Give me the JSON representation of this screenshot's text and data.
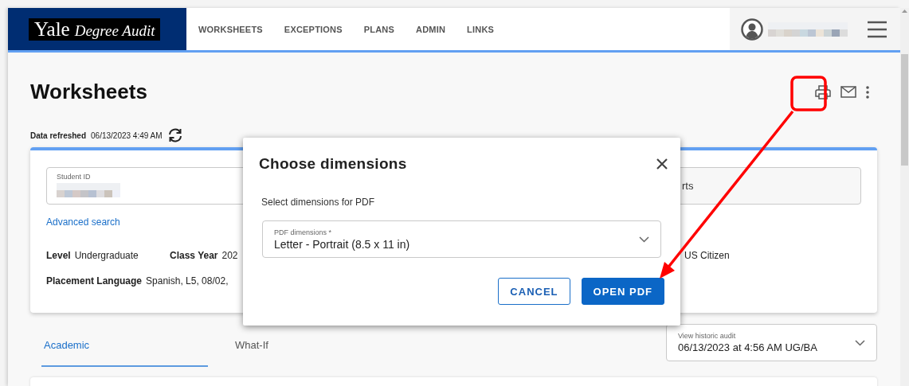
{
  "header": {
    "logo": {
      "brand": "Yale",
      "product": "Degree Audit"
    },
    "nav": [
      {
        "label": "WORKSHEETS"
      },
      {
        "label": "EXCEPTIONS"
      },
      {
        "label": "PLANS"
      },
      {
        "label": "ADMIN"
      },
      {
        "label": "LINKS"
      }
    ]
  },
  "page": {
    "title": "Worksheets",
    "refreshed_label": "Data refreshed",
    "refreshed_value": "06/13/2023 4:49 AM"
  },
  "search_card": {
    "student_id_label": "Student ID",
    "field_2_value": "rts",
    "link": "Advanced search",
    "info": [
      {
        "label": "Level",
        "value": "Undergraduate"
      },
      {
        "label": "Class Year",
        "value": "202"
      }
    ],
    "info_right_value": "US Citizen",
    "info_row2": {
      "label": "Placement Language",
      "value": "Spanish, L5, 08/02,"
    }
  },
  "tabs": [
    {
      "label": "Academic",
      "selected": true
    },
    {
      "label": "What-If",
      "selected": false
    }
  ],
  "history": {
    "label": "View historic audit",
    "value": "06/13/2023 at 4:56 AM UG/BA"
  },
  "dialog": {
    "title": "Choose dimensions",
    "prompt": "Select dimensions for PDF",
    "select": {
      "label": "PDF dimensions *",
      "value": "Letter - Portrait (8.5 x 11 in)"
    },
    "buttons": [
      {
        "label": "CANCEL",
        "kind": "secondary"
      },
      {
        "label": "OPEN PDF",
        "kind": "primary"
      }
    ]
  }
}
